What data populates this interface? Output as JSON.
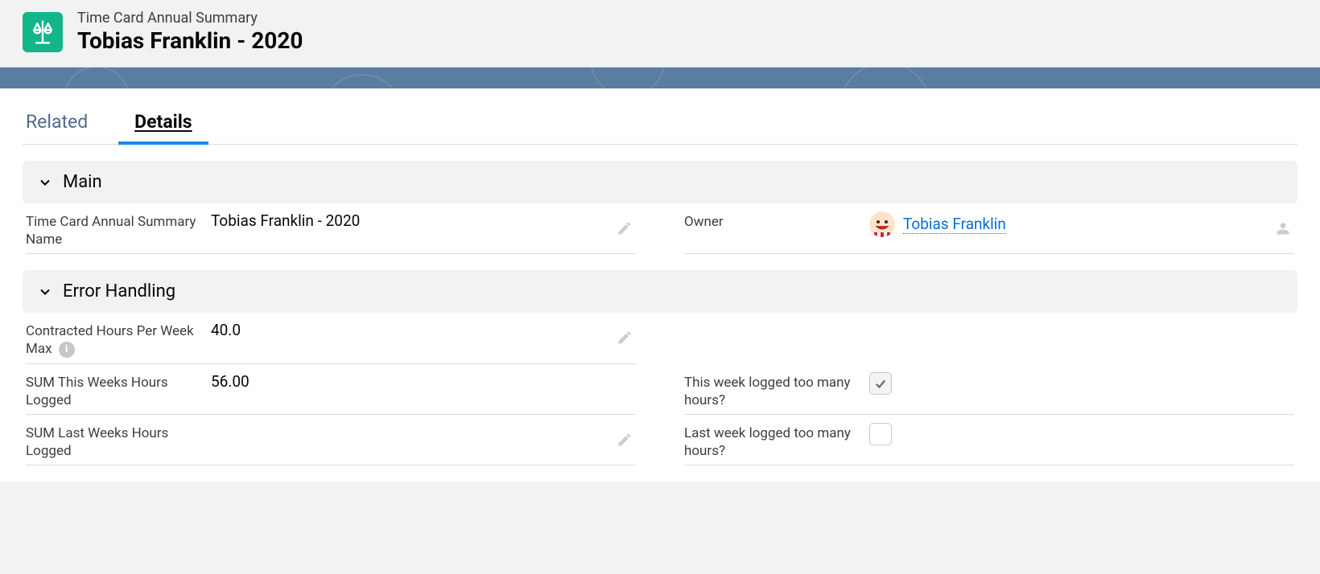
{
  "header": {
    "type_label": "Time Card Annual Summary",
    "title": "Tobias Franklin - 2020"
  },
  "tabs": {
    "related": "Related",
    "details": "Details",
    "active": "details"
  },
  "sections": {
    "main": {
      "title": "Main",
      "fields": {
        "name": {
          "label": "Time Card Annual Summary Name",
          "value": "Tobias Franklin - 2020"
        },
        "owner": {
          "label": "Owner",
          "value": "Tobias Franklin"
        }
      }
    },
    "error_handling": {
      "title": "Error Handling",
      "fields": {
        "contracted_max": {
          "label": "Contracted Hours Per Week Max",
          "value": "40.0"
        },
        "sum_this_week": {
          "label": "SUM This Weeks Hours Logged",
          "value": "56.00"
        },
        "sum_last_week": {
          "label": "SUM Last Weeks Hours Logged",
          "value": ""
        },
        "this_week_flag": {
          "label": "This week logged too many hours?",
          "checked": true
        },
        "last_week_flag": {
          "label": "Last week logged too many hours?",
          "checked": false
        }
      }
    }
  }
}
